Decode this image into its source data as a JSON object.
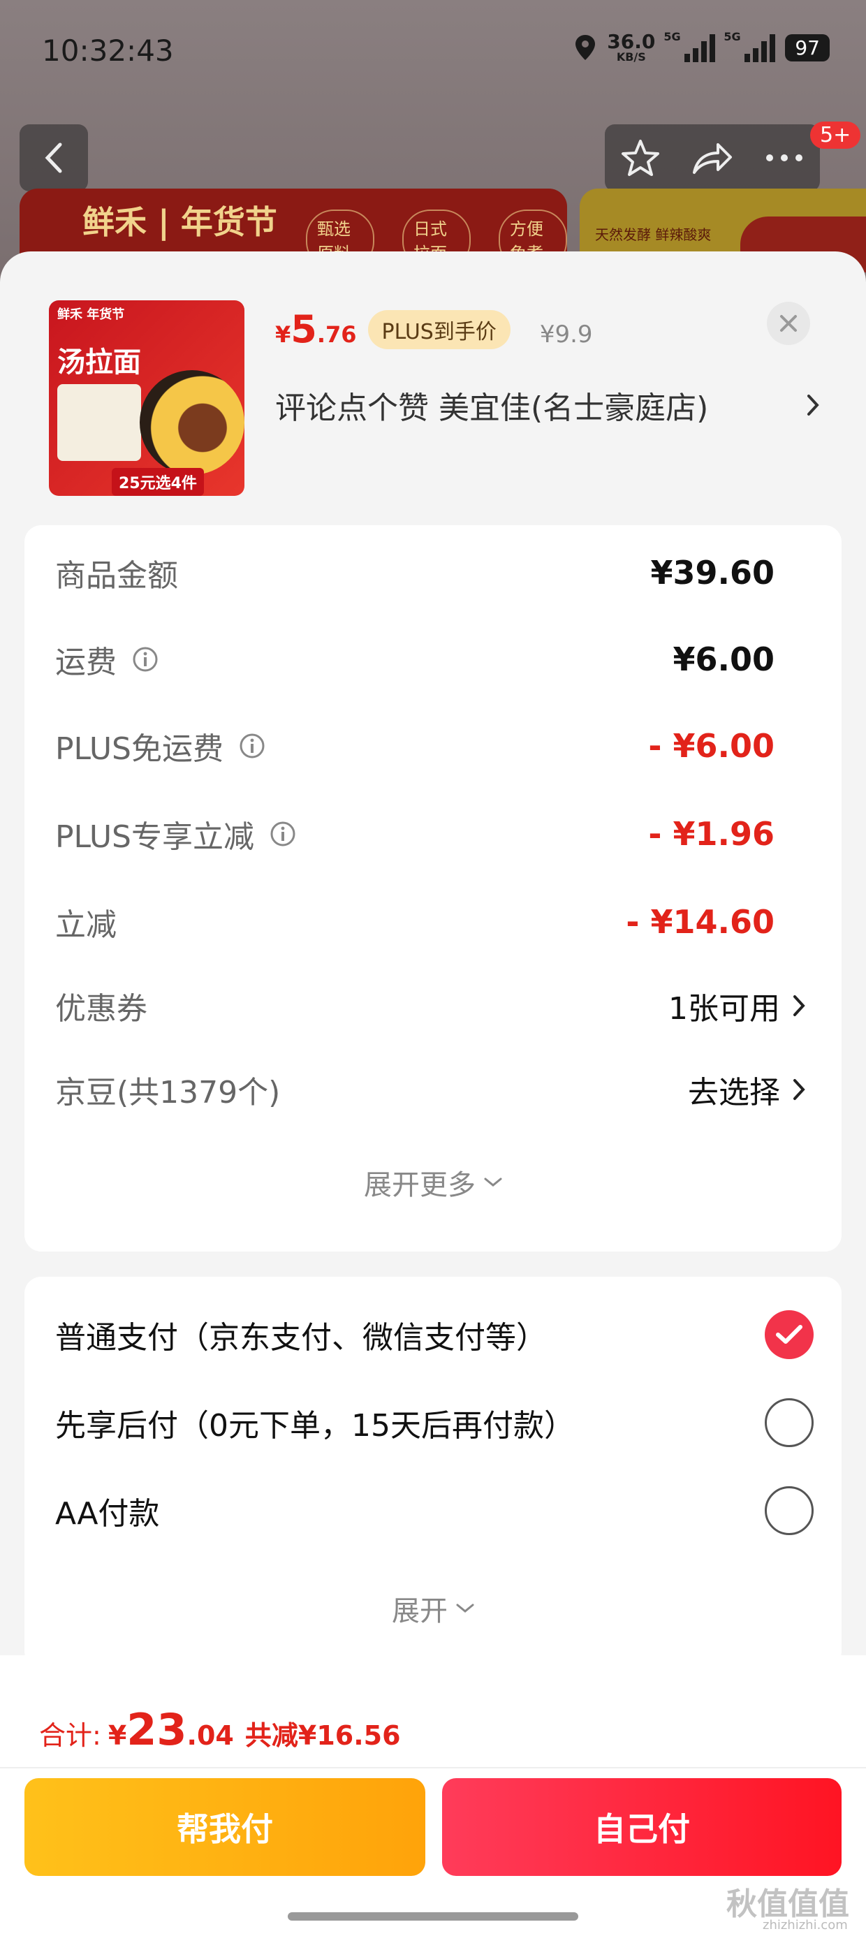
{
  "status_bar": {
    "time": "10:32:43",
    "net_speed": "36.0",
    "net_unit": "KB/S",
    "signal1_label": "5G",
    "signal2_label": "5G",
    "battery": "97"
  },
  "nav": {
    "badge": "5+"
  },
  "banner": {
    "logo": "鲜禾 | 年货节",
    "tags": [
      "甄选原料",
      "日式拉面",
      "方便免煮"
    ],
    "right_text": "天然发酵 鲜辣酸爽"
  },
  "product": {
    "image_text_brand": "鲜禾 年货节",
    "image_text_name": "汤拉面",
    "image_deal": "25元选4件",
    "price_currency": "¥",
    "price_int": "5",
    "price_dec": ".76",
    "plus_tag": "PLUS到手价",
    "price_old": "¥9.9",
    "shop_text": "评论点个赞  美宜佳(名士豪庭店)"
  },
  "summary": {
    "rows": [
      {
        "label": "商品金额",
        "value": "¥39.60"
      },
      {
        "label": "运费",
        "value": "¥6.00"
      },
      {
        "label": "PLUS免运费",
        "value": "- ¥6.00"
      },
      {
        "label": "PLUS专享立减",
        "value": "- ¥1.96"
      },
      {
        "label": "立减",
        "value": "- ¥14.60"
      },
      {
        "label": "优惠券",
        "value": "1张可用"
      },
      {
        "label": "京豆(共1379个)",
        "value": "去选择"
      }
    ],
    "expand_label": "展开更多"
  },
  "payment": {
    "options": [
      {
        "label": "普通支付（京东支付、微信支付等）",
        "selected": true
      },
      {
        "label": "先享后付（0元下单，15天后再付款）",
        "selected": false
      },
      {
        "label": "AA付款",
        "selected": false
      }
    ],
    "expand_label": "展开"
  },
  "footer": {
    "total_label": "合计:",
    "total_currency": "¥",
    "total_int": "23",
    "total_dec": ".04",
    "savings": "共减¥16.56",
    "help_pay_label": "帮我付",
    "self_pay_label": "自己付"
  },
  "watermark": {
    "text": "秋值值值",
    "sub": "zhizhizhi.com"
  },
  "colors": {
    "accent_red": "#e2231a",
    "plus_tag_bg": "#fbe5b4",
    "help_button": "#ffb010",
    "self_button": "#ff2136"
  }
}
